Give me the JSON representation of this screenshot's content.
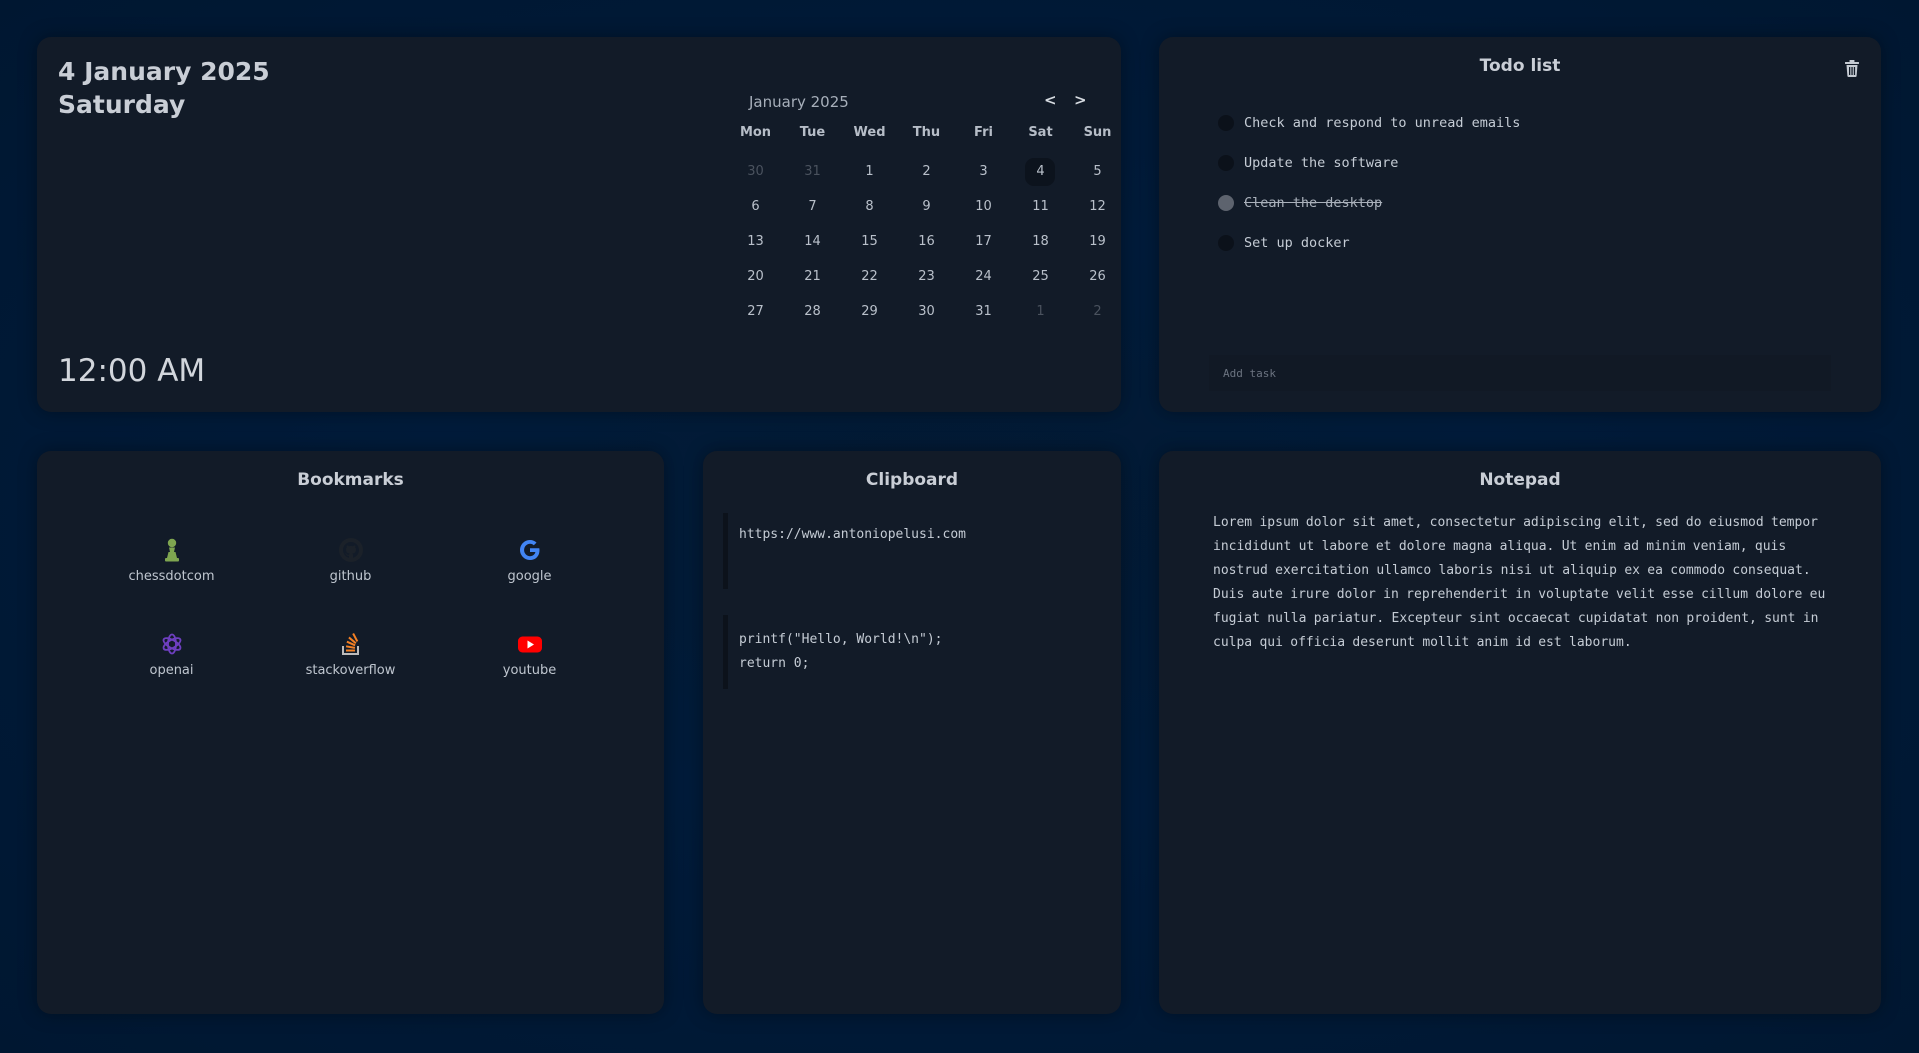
{
  "date_card": {
    "date": "4 January 2025",
    "weekday": "Saturday",
    "time": "12:00 AM"
  },
  "calendar": {
    "month_label": "January 2025",
    "prev_label": "<",
    "next_label": ">",
    "weekdays": [
      "Mon",
      "Tue",
      "Wed",
      "Thu",
      "Fri",
      "Sat",
      "Sun"
    ],
    "weeks": [
      [
        {
          "d": "30",
          "muted": true
        },
        {
          "d": "31",
          "muted": true
        },
        {
          "d": "1"
        },
        {
          "d": "2"
        },
        {
          "d": "3"
        },
        {
          "d": "4",
          "today": true
        },
        {
          "d": "5"
        }
      ],
      [
        {
          "d": "6"
        },
        {
          "d": "7"
        },
        {
          "d": "8"
        },
        {
          "d": "9"
        },
        {
          "d": "10"
        },
        {
          "d": "11"
        },
        {
          "d": "12"
        }
      ],
      [
        {
          "d": "13"
        },
        {
          "d": "14"
        },
        {
          "d": "15"
        },
        {
          "d": "16"
        },
        {
          "d": "17"
        },
        {
          "d": "18"
        },
        {
          "d": "19"
        }
      ],
      [
        {
          "d": "20"
        },
        {
          "d": "21"
        },
        {
          "d": "22"
        },
        {
          "d": "23"
        },
        {
          "d": "24"
        },
        {
          "d": "25"
        },
        {
          "d": "26"
        }
      ],
      [
        {
          "d": "27"
        },
        {
          "d": "28"
        },
        {
          "d": "29"
        },
        {
          "d": "30"
        },
        {
          "d": "31"
        },
        {
          "d": "1",
          "muted": true
        },
        {
          "d": "2",
          "muted": true
        }
      ]
    ]
  },
  "todo": {
    "title": "Todo list",
    "trash_icon": "trash-icon",
    "items": [
      {
        "text": "Check and respond to unread emails",
        "done": false
      },
      {
        "text": "Update the software",
        "done": false
      },
      {
        "text": "Clean the desktop",
        "done": true
      },
      {
        "text": "Set up docker",
        "done": false
      }
    ],
    "add_placeholder": "Add task"
  },
  "bookmarks": {
    "title": "Bookmarks",
    "items": [
      {
        "label": "chessdotcom",
        "icon": "chess-pawn-icon",
        "color": "#7fa650"
      },
      {
        "label": "github",
        "icon": "github-icon",
        "color": "#1e242c"
      },
      {
        "label": "google",
        "icon": "google-icon",
        "color": "#4285f4"
      },
      {
        "label": "openai",
        "icon": "openai-icon",
        "color": "#6e3fc0"
      },
      {
        "label": "stackoverflow",
        "icon": "stackoverflow-icon",
        "color": "#f48024"
      },
      {
        "label": "youtube",
        "icon": "youtube-icon",
        "color": "#ff0000"
      }
    ]
  },
  "clipboard": {
    "title": "Clipboard",
    "items": [
      "https://www.antoniopelusi.com",
      "printf(\"Hello, World!\\n\");\nreturn 0;"
    ]
  },
  "notepad": {
    "title": "Notepad",
    "text": "Lorem ipsum dolor sit amet, consectetur adipiscing elit, sed do eiusmod tempor incididunt ut labore et dolore magna aliqua. Ut enim ad minim veniam, quis nostrud exercitation ullamco laboris nisi ut aliquip ex ea commodo consequat. Duis aute irure dolor in reprehenderit in voluptate velit esse cillum dolore eu fugiat nulla pariatur. Excepteur sint occaecat cupidatat non proident, sunt in culpa qui officia deserunt mollit anim id est laborum."
  },
  "colors": {
    "background": "#011b3a",
    "card": "#121b28",
    "text": "#c5ccd5"
  }
}
